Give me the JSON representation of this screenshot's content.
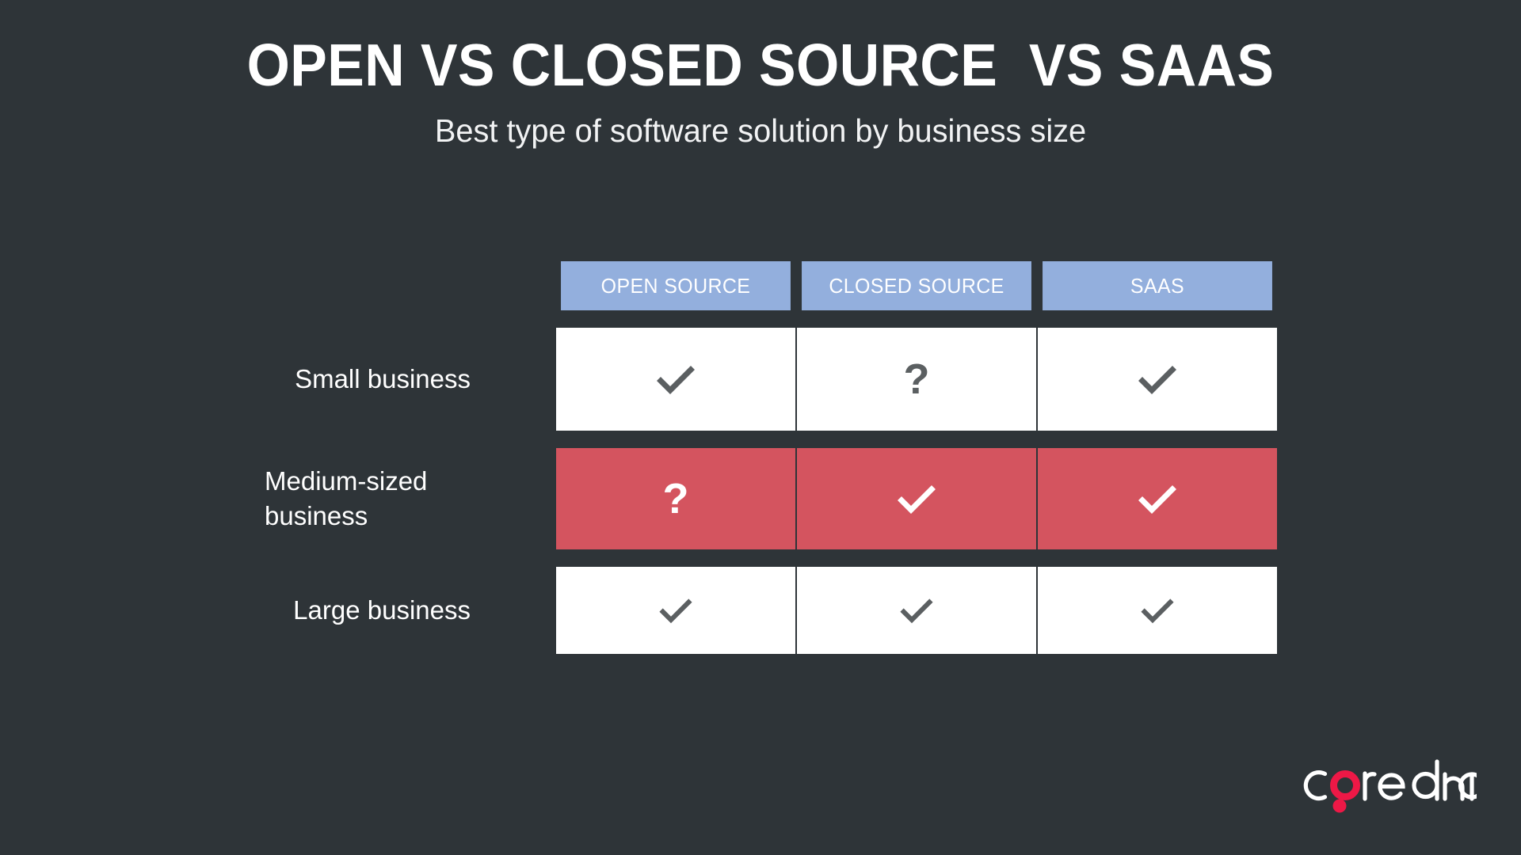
{
  "page": {
    "background_color": "#2e3438",
    "title": "OPEN VS CLOSED SOURCE  VS SAAS",
    "subtitle": "Best type of software solution by business size"
  },
  "colors": {
    "background": "#2e3438",
    "header_blue": "#93afdd",
    "highlight_red": "#d4545f",
    "cell_white": "#ffffff",
    "glyph_dark": "#5b5f61",
    "glyph_light": "#ffffff",
    "logo_red": "#ed1846",
    "logo_text": "#ffffff"
  },
  "matrix": {
    "columns": [
      {
        "label": "OPEN SOURCE"
      },
      {
        "label": "CLOSED SOURCE"
      },
      {
        "label": "SAAS"
      }
    ],
    "rows": [
      {
        "label": "Small business",
        "highlighted": false,
        "cells": [
          {
            "icon": "check-icon",
            "value": "yes",
            "glyph": "✔"
          },
          {
            "icon": "question-mark-icon",
            "value": "maybe",
            "glyph": "?"
          },
          {
            "icon": "check-icon",
            "value": "yes",
            "glyph": "✔"
          }
        ]
      },
      {
        "label": "Medium-sized business",
        "highlighted": true,
        "cells": [
          {
            "icon": "question-mark-icon",
            "value": "maybe",
            "glyph": "?"
          },
          {
            "icon": "check-icon",
            "value": "yes",
            "glyph": "✔"
          },
          {
            "icon": "check-icon",
            "value": "yes",
            "glyph": "✔"
          }
        ]
      },
      {
        "label": "Large business",
        "highlighted": false,
        "cells": [
          {
            "icon": "check-icon",
            "value": "yes",
            "glyph": "✔"
          },
          {
            "icon": "check-icon",
            "value": "yes",
            "glyph": "✔"
          },
          {
            "icon": "check-icon",
            "value": "yes",
            "glyph": "✔"
          }
        ]
      }
    ]
  },
  "logo": {
    "name": "core-dna-logo",
    "text_before": "c",
    "text_after": "re dna",
    "full_text": "core dna"
  }
}
